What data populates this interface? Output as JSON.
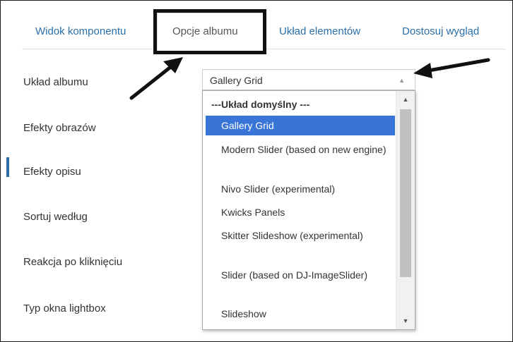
{
  "tabs": [
    {
      "label": "Widok komponentu"
    },
    {
      "label": "Opcje albumu"
    },
    {
      "label": "Układ elementów"
    },
    {
      "label": "Dostosuj wygląd"
    }
  ],
  "fields": [
    {
      "label": "Układ albumu"
    },
    {
      "label": "Efekty obrazów"
    },
    {
      "label": "Efekty opisu"
    },
    {
      "label": "Sortuj według"
    },
    {
      "label": "Reakcja po kliknięciu"
    },
    {
      "label": "Typ okna lightbox"
    }
  ],
  "album_layout_select": {
    "value": "Gallery Grid",
    "options": [
      {
        "label": "---Układ domyślny ---",
        "group": true
      },
      {
        "label": "Gallery Grid",
        "selected": true
      },
      {
        "label": "Modern Slider (based on new engine)"
      },
      {
        "label": "Nivo Slider (experimental)"
      },
      {
        "label": "Kwicks Panels"
      },
      {
        "label": "Skitter Slideshow (experimental)"
      },
      {
        "label": "Slider (based on DJ-ImageSlider)"
      },
      {
        "label": "Slideshow"
      }
    ]
  },
  "colors": {
    "link": "#2a6fa8",
    "selected_option": "#3875d7",
    "annotation": "#111111"
  }
}
